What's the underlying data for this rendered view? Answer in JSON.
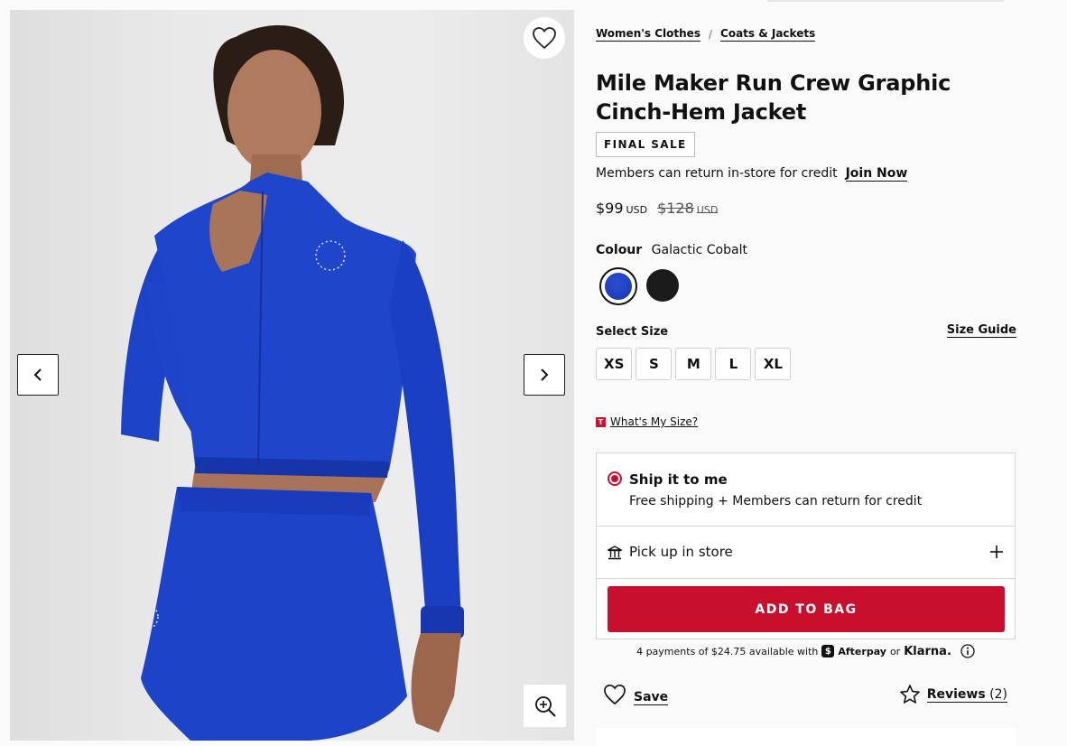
{
  "breadcrumb": {
    "items": [
      "Women's Clothes",
      "Coats & Jackets"
    ],
    "separator": "/"
  },
  "product": {
    "title": "Mile Maker Run Crew Graphic Cinch-Hem Jacket",
    "badge": "FINAL SALE",
    "member_note": "Members can return in-store for credit",
    "join_link": "Join Now",
    "price": {
      "sale": "$99",
      "sale_currency": "USD",
      "original": "$128",
      "original_currency": "USD"
    }
  },
  "colour": {
    "label": "Colour",
    "selected": "Galactic Cobalt",
    "swatch_colors": [
      "#1f3fc4",
      "#1b1b1b"
    ]
  },
  "size": {
    "label": "Select Size",
    "guide": "Size Guide",
    "options": [
      "XS",
      "S",
      "M",
      "L",
      "XL"
    ],
    "fit_link": "What's My Size?"
  },
  "fulfillment": {
    "ship_title": "Ship it to me",
    "ship_subtitle": "Free shipping + Members can return for credit",
    "pickup_label": "Pick up in store",
    "add_button": "ADD TO BAG"
  },
  "payments": {
    "text": "4 payments of $24.75 available with",
    "afterpay": "Afterpay",
    "or": "or",
    "klarna": "Klarna."
  },
  "actions": {
    "save": "Save",
    "reviews_label": "Reviews",
    "reviews_count": "(2)"
  },
  "accent_color": "#c8102e"
}
